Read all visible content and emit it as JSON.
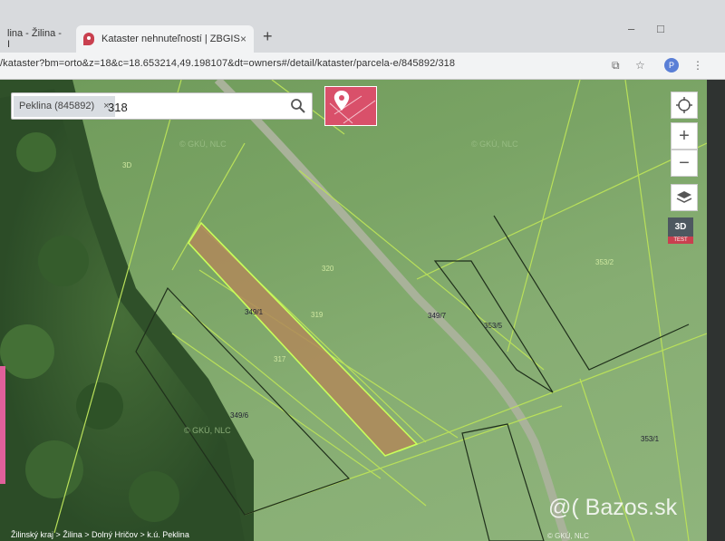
{
  "browser": {
    "tabs": [
      {
        "label": "lina - Žilina - I",
        "active": false
      },
      {
        "label": "Kataster nehnuteľností | ZBGIS",
        "active": true
      }
    ],
    "new_tab_label": "+",
    "url": "/kataster?bm=orto&z=18&c=18.653214,49.198107&dt=owners#/detail/kataster/parcela-e/845892/318",
    "profile_initial": "P",
    "window_controls": [
      "–",
      "□"
    ]
  },
  "search": {
    "chip_label": "Peklina (845892)",
    "chip_close": "×",
    "value": "318"
  },
  "map": {
    "parcel_labels": [
      {
        "text": "349/1",
        "sel": true
      },
      {
        "text": "319"
      },
      {
        "text": "320"
      },
      {
        "text": "317"
      },
      {
        "text": "349/6"
      },
      {
        "text": "349/7"
      },
      {
        "text": "353/5"
      },
      {
        "text": "353/1"
      },
      {
        "text": "353/2"
      },
      {
        "text": "3D"
      }
    ],
    "attribution_marks": [
      "© GKÚ, NLC",
      "© GKÚ, NLC",
      "© GKÚ, NLC"
    ],
    "breadcrumb": "Žilinský kraj > Žilina > Dolný Hričov > k.ú. Peklina",
    "copyright": "© GKÚ, NLC",
    "watermark": "@( Bazos.sk"
  },
  "controls": {
    "locate_icon": "crosshair-icon",
    "zoom_in": "+",
    "zoom_out": "−",
    "layers_icon": "layers-icon",
    "mode_3d_label": "3D",
    "mode_3d_tag": "TEST"
  },
  "colors": {
    "brand": "#c9404f",
    "parcel_line": "#b9e05a",
    "selected_parcel_fill": "#b0885a"
  }
}
